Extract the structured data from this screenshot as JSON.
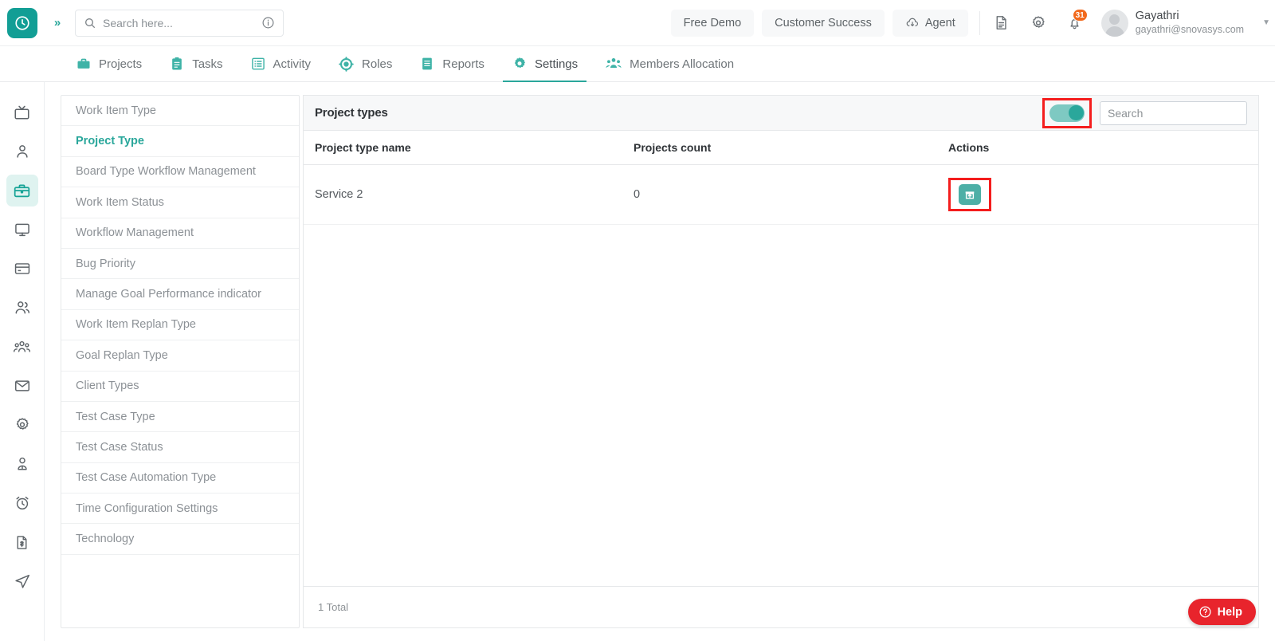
{
  "header": {
    "search": {
      "placeholder": "Search here...",
      "value": "",
      "icon": "search-icon",
      "info_icon": "info-icon"
    },
    "expand_icon": "chevron-double-right-icon",
    "logo_icon": "clock-logo-icon",
    "buttons": [
      {
        "label": "Free Demo",
        "name": "free-demo-button",
        "icon": null
      },
      {
        "label": "Customer Success",
        "name": "customer-success-button",
        "icon": null
      },
      {
        "label": "Agent",
        "name": "agent-button",
        "icon": "cloud-download-icon"
      }
    ],
    "icons": [
      {
        "name": "document-icon"
      },
      {
        "name": "gear-icon"
      },
      {
        "name": "bell-icon",
        "badge": "31"
      }
    ],
    "user": {
      "name": "Gayathri",
      "email": "gayathri@snovasys.com",
      "avatar": "avatar",
      "caret": "chevron-down-icon"
    }
  },
  "nav": {
    "tabs": [
      {
        "label": "Projects",
        "icon": "briefcase-icon",
        "active": false
      },
      {
        "label": "Tasks",
        "icon": "clipboard-icon",
        "active": false
      },
      {
        "label": "Activity",
        "icon": "list-grid-icon",
        "active": false
      },
      {
        "label": "Roles",
        "icon": "target-icon",
        "active": false
      },
      {
        "label": "Reports",
        "icon": "report-icon",
        "active": false
      },
      {
        "label": "Settings",
        "icon": "gear-icon",
        "active": true
      },
      {
        "label": "Members Allocation",
        "icon": "people-group-icon",
        "active": false
      }
    ]
  },
  "rail": {
    "items": [
      {
        "name": "rail-item-target",
        "icon": "spiral-target-icon",
        "active": false
      },
      {
        "name": "rail-item-tv",
        "icon": "tv-icon",
        "active": false
      },
      {
        "name": "rail-item-user",
        "icon": "user-icon",
        "active": false
      },
      {
        "name": "rail-item-projects",
        "icon": "briefcase-icon",
        "active": true
      },
      {
        "name": "rail-item-monitor",
        "icon": "monitor-icon",
        "active": false
      },
      {
        "name": "rail-item-billing",
        "icon": "credit-card-icon",
        "active": false
      },
      {
        "name": "rail-item-users",
        "icon": "users-icon",
        "active": false
      },
      {
        "name": "rail-item-teams",
        "icon": "people-group-icon",
        "active": false
      },
      {
        "name": "rail-item-mail",
        "icon": "envelope-icon",
        "active": false
      },
      {
        "name": "rail-item-settings",
        "icon": "gear-icon",
        "active": false
      },
      {
        "name": "rail-item-profile",
        "icon": "person-badge-icon",
        "active": false
      },
      {
        "name": "rail-item-timer",
        "icon": "alarm-clock-icon",
        "active": false
      },
      {
        "name": "rail-item-invoice",
        "icon": "invoice-dollar-icon",
        "active": false
      },
      {
        "name": "rail-item-send",
        "icon": "paper-plane-icon",
        "active": false
      }
    ]
  },
  "settings_menu": {
    "items": [
      {
        "label": "Work Item Type",
        "active": false
      },
      {
        "label": "Project Type",
        "active": true
      },
      {
        "label": "Board Type Workflow Management",
        "active": false
      },
      {
        "label": "Work Item Status",
        "active": false
      },
      {
        "label": "Workflow Management",
        "active": false
      },
      {
        "label": "Bug Priority",
        "active": false
      },
      {
        "label": "Manage Goal Performance indicator",
        "active": false
      },
      {
        "label": "Work Item Replan Type",
        "active": false
      },
      {
        "label": "Goal Replan Type",
        "active": false
      },
      {
        "label": "Client Types",
        "active": false
      },
      {
        "label": "Test Case Type",
        "active": false
      },
      {
        "label": "Test Case Status",
        "active": false
      },
      {
        "label": "Test Case Automation Type",
        "active": false
      },
      {
        "label": "Time Configuration Settings",
        "active": false
      },
      {
        "label": "Technology",
        "active": false
      }
    ]
  },
  "panel": {
    "title": "Project types",
    "toggle": {
      "name": "show-archived-toggle",
      "state": "on",
      "highlighted": true
    },
    "search": {
      "placeholder": "Search",
      "value": ""
    },
    "columns": [
      "Project type name",
      "Projects count",
      "Actions"
    ],
    "rows": [
      {
        "name": "Service 2",
        "count": "0",
        "action_icon": "unarchive-icon",
        "action_highlighted": true
      }
    ],
    "footer": "1 Total"
  },
  "help": {
    "label": "Help",
    "icon": "question-circle-icon"
  },
  "colors": {
    "accent": "#2aa79b",
    "accent_light": "#dff3f0",
    "highlight": "#f41d1d",
    "badge": "#f2691c",
    "help_red": "#e8242c"
  }
}
